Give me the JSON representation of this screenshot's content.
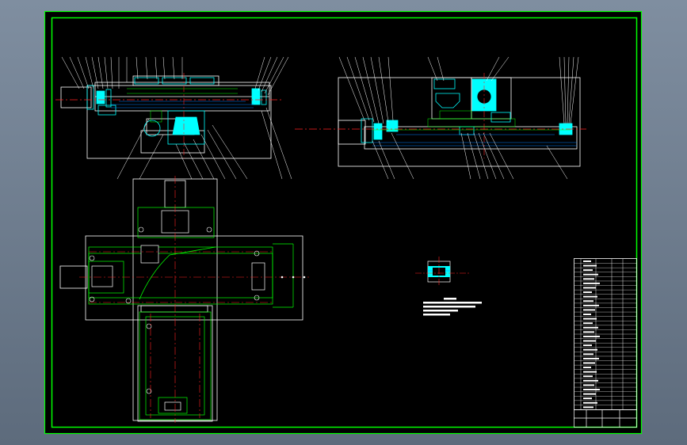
{
  "colors": {
    "background": "#6f7e90",
    "sheet": "#000000",
    "border": "#00ff00",
    "outline": "#ffffff",
    "part": "#00ffff",
    "centerline": "#ff2020",
    "hatch": "#0080ff",
    "accent": "#ffff00"
  },
  "sections": [
    "front-section-view",
    "side-section-view",
    "plan-view",
    "detail-view",
    "technical-notes",
    "parts-list",
    "title-block"
  ],
  "parts_list_rows": 34
}
